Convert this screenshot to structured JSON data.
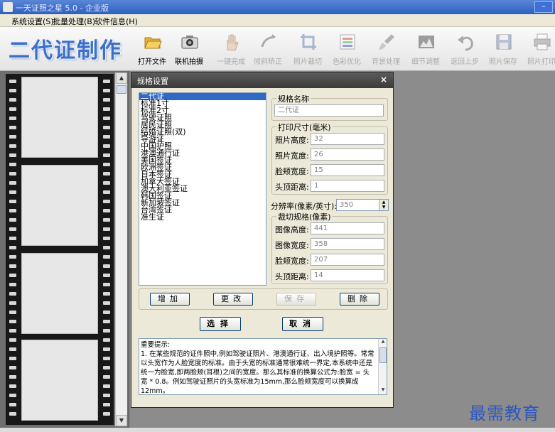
{
  "window": {
    "title": "一天证照之星 5.0 - 企业版"
  },
  "menu": [
    "系统设置(S)",
    "批量处理(B)",
    "软件信息(H)"
  ],
  "toolbar": {
    "brand": "二代证制作",
    "tools": [
      {
        "label": "打开文件",
        "icon": "folder-open-icon",
        "enabled": true
      },
      {
        "label": "联机拍摄",
        "icon": "camera-icon",
        "enabled": true
      },
      {
        "label": "一键完成",
        "icon": "hand-icon",
        "enabled": false
      },
      {
        "label": "倾斜矫正",
        "icon": "tilt-icon",
        "enabled": false
      },
      {
        "label": "照片裁切",
        "icon": "crop-icon",
        "enabled": false
      },
      {
        "label": "色彩优化",
        "icon": "color-icon",
        "enabled": false
      },
      {
        "label": "背景处理",
        "icon": "brush-icon",
        "enabled": false
      },
      {
        "label": "细节调整",
        "icon": "detail-icon",
        "enabled": false
      },
      {
        "label": "返回上步",
        "icon": "undo-icon",
        "enabled": false
      },
      {
        "label": "照片保存",
        "icon": "save-icon",
        "enabled": false
      },
      {
        "label": "照片打印",
        "icon": "printer-icon",
        "enabled": false
      }
    ]
  },
  "dialog": {
    "title": "规格设置",
    "close": "×",
    "spec_list": [
      "二代证",
      "标准1寸",
      "标准2寸",
      "驾驶证照",
      "居民证照",
      "结婚证照(双)",
      "导游证",
      "中国护照",
      "港澳通行证",
      "美国签证",
      "欧洲签证",
      "日本签证",
      "加拿大签证",
      "澳大利亚签证",
      "韩国签证",
      "新加坡签证",
      "台湾签证",
      "准生证"
    ],
    "selected_index": 0,
    "name_group": {
      "legend": "规格名称",
      "value": "二代证"
    },
    "print_group": {
      "legend": "打印尺寸(毫米)",
      "rows": [
        {
          "label": "照片高度:",
          "value": "32"
        },
        {
          "label": "照片宽度:",
          "value": "26"
        },
        {
          "label": "脸颊宽度:",
          "value": "15"
        },
        {
          "label": "头顶距离:",
          "value": "1"
        }
      ]
    },
    "resolution": {
      "label": "分辨率(像素/英寸):",
      "value": "350"
    },
    "crop_group": {
      "legend": "裁切规格(像素)",
      "rows": [
        {
          "label": "图像高度:",
          "value": "441"
        },
        {
          "label": "图像宽度:",
          "value": "358"
        },
        {
          "label": "脸颊宽度:",
          "value": "207"
        },
        {
          "label": "头顶距离:",
          "value": "14"
        }
      ]
    },
    "buttons": {
      "add": "增加",
      "edit": "更改",
      "save": "保存",
      "delete": "删除",
      "select": "选择",
      "cancel": "取消"
    },
    "tips": "重要提示:\n1. 在某些规范的证件照中,例如驾驶证照片、港澳通行证、出入境护照等。常常以头宽作为人脸宽度的标准。由于头宽的标准通常很难统一界定,本系统中还是统一为脸宽,即两脸颊(耳根)之间的宽度。那么其标准的换算公式为:脸宽 = 头宽 * 0.8。例如驾驶证照片的头宽标准为15mm,那么脸颊宽度可以换算成12mm。"
  },
  "corner_watermark": "最需教育",
  "colors": {
    "brand": "#3b6fc9",
    "titlebar": "#2f5fbf",
    "selection": "#316ac5"
  }
}
